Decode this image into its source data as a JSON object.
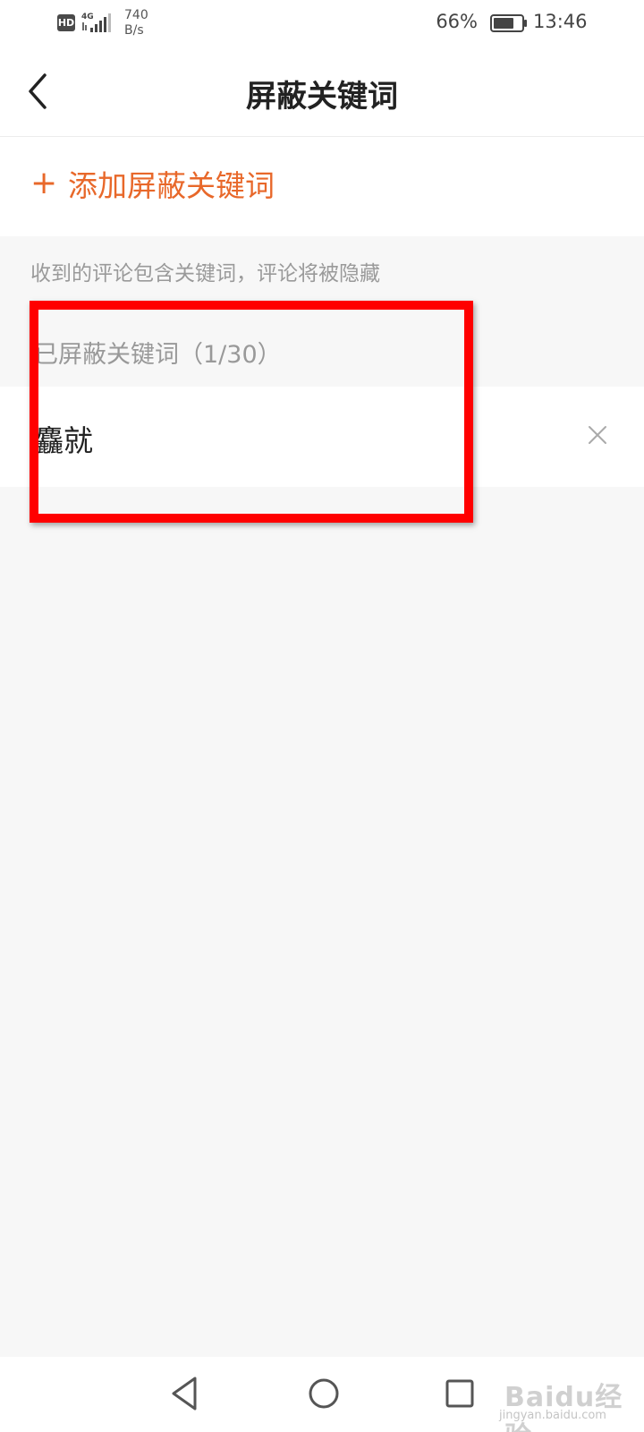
{
  "status_bar": {
    "hd_badge": "HD",
    "network_type": "4G",
    "speed_value": "740",
    "speed_unit": "B/s",
    "battery_percent": "66%",
    "time": "13:46"
  },
  "header": {
    "title": "屏蔽关键词",
    "back_icon": "chevron-left-icon"
  },
  "add_row": {
    "plus_symbol": "+",
    "label": "添加屏蔽关键词"
  },
  "hint": "收到的评论包含关键词，评论将被隐藏",
  "section": {
    "title": "已屏蔽关键词（1/30）"
  },
  "keywords": [
    {
      "text": "麤就",
      "delete_icon": "close-icon"
    }
  ],
  "nav_bar": {
    "back_icon": "triangle-back-icon",
    "home_icon": "circle-home-icon",
    "recents_icon": "square-recents-icon"
  },
  "watermark": {
    "text": "Baidu经验",
    "sub": "jingyan.baidu.com"
  },
  "colors": {
    "accent": "#e8682a",
    "highlight": "#ff0000",
    "background": "#f7f7f7"
  }
}
